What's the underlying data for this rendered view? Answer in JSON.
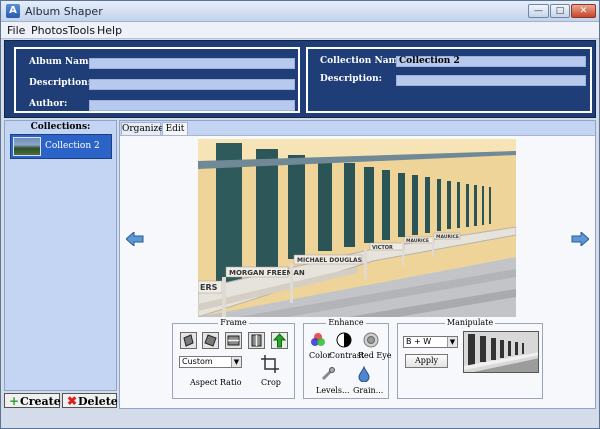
{
  "window": {
    "title": "Album Shaper"
  },
  "menu": [
    "File",
    "Photos",
    "Tools",
    "Help"
  ],
  "album": {
    "name_label": "Album Name:",
    "name_value": "",
    "description_label": "Description:",
    "description_value": "",
    "author_label": "Author:",
    "author_value": ""
  },
  "collection_info": {
    "name_label": "Collection Name:",
    "name_value": "Collection 2",
    "description_label": "Description:",
    "description_value": ""
  },
  "collections": {
    "title": "Collections:",
    "items": [
      {
        "label": "Collection 2"
      }
    ],
    "create_label": "Create",
    "delete_label": "Delete"
  },
  "tabs": [
    "Organize",
    "Edit"
  ],
  "photo": {
    "signs": [
      "MORGAN FREEMAN",
      "MICHAEL DOUGLAS",
      "VICTOR",
      "MAURICE",
      "MAURICE",
      "ERS"
    ]
  },
  "frame": {
    "title": "Frame",
    "aspect_value": "Custom",
    "aspect_label": "Aspect Ratio",
    "crop_label": "Crop"
  },
  "enhance": {
    "title": "Enhance",
    "color_label": "Color",
    "contrast_label": "Contrast",
    "redeye_label": "Red Eye",
    "levels_label": "Levels...",
    "grain_label": "Grain..."
  },
  "manipulate": {
    "title": "Manipulate",
    "effect_value": "B + W",
    "apply_label": "Apply"
  },
  "colors": {
    "info_band": "#1f3d77",
    "field": "#b8c9ee",
    "selection": "#2b63c6"
  }
}
